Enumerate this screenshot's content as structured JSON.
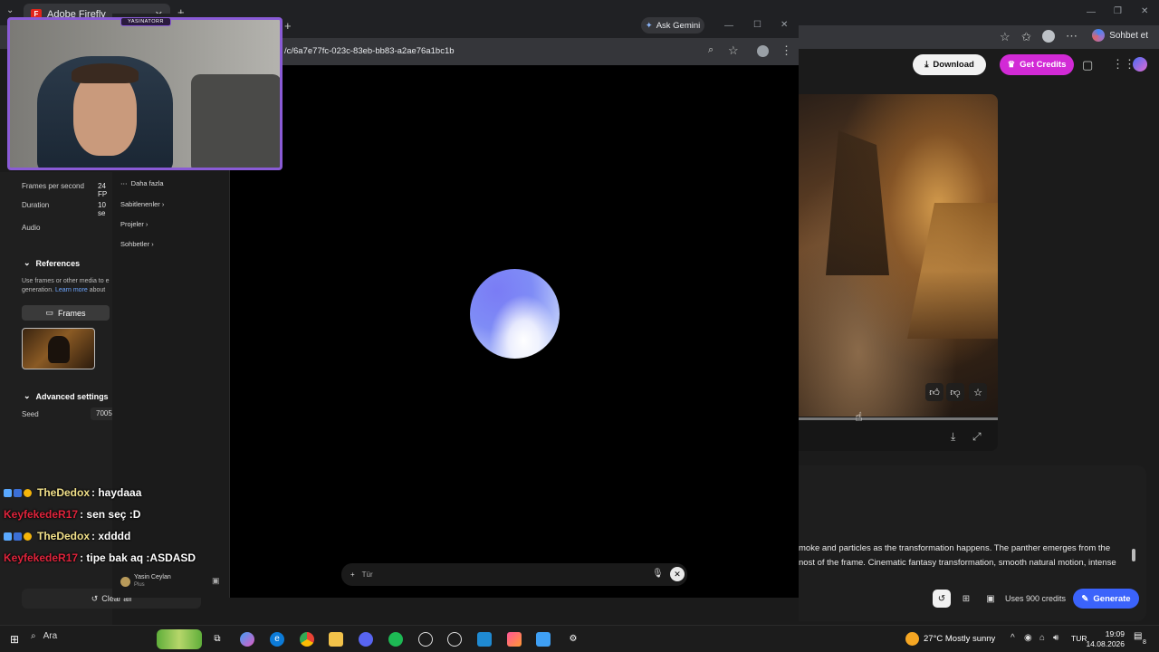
{
  "outer_browser": {
    "tab_title": "Adobe Firefly",
    "tab_close": "✕",
    "new_tab": "+",
    "chat_button": "Sohbet et"
  },
  "firefly": {
    "settings": {
      "fps_label": "Frames per second",
      "fps_value": "24 FP",
      "duration_label": "Duration",
      "duration_value": "10 se",
      "audio_label": "Audio"
    },
    "references": {
      "title": "References",
      "desc_line1": "Use frames or other media to e",
      "desc_line2_prefix": "generation. ",
      "learn_more": "Learn more",
      "desc_line2_suffix": " about",
      "frames_tab": "Frames"
    },
    "advanced": {
      "title": "Advanced settings",
      "seed_label": "Seed",
      "seed_value": "7005"
    },
    "clear_all": "Clear all",
    "header": {
      "download": "Download",
      "get_credits": "Get Credits"
    },
    "prompt": {
      "line1": "moke and particles as the transformation happens. The panther emerges from the",
      "line2": "nost of the frame. Cinematic fantasy transformation, smooth natural motion, intense"
    },
    "footer": {
      "credits": "Uses 900 credits",
      "generate": "Generate"
    }
  },
  "popup": {
    "ask_gemini": "Ask Gemini",
    "url": "/c/6a7e77fc-023c-83eb-bb83-a2ae76a1bc1b",
    "menu": {
      "more": "Daha fazla",
      "pinned": "Sabitlenenler",
      "projects": "Projeler",
      "chats": "Sohbetler"
    },
    "user": {
      "name": "Yasin Ceylan",
      "plan": "Plus"
    },
    "input_placeholder": "Tür"
  },
  "webcam": {
    "tag": "YASINATORR"
  },
  "chat": [
    {
      "user": "TheDedox",
      "message": " : haydaaa",
      "color": "#f2e18a",
      "badges": true
    },
    {
      "user": "KeyfekedeR17",
      "message": " : sen seç :D",
      "color": "#e0243c",
      "badges": false
    },
    {
      "user": "TheDedox",
      "message": " : xdddd",
      "color": "#f2e18a",
      "badges": true
    },
    {
      "user": "KeyfekedeR17",
      "message": " : tipe bak aq :ASDASD",
      "color": "#e0243c",
      "badges": false
    }
  ],
  "taskbar": {
    "search": "Ara",
    "weather": "27°C  Mostly sunny",
    "lang": "TUR",
    "time": "19:09",
    "date": "14.08.2026",
    "notifications": "8"
  }
}
